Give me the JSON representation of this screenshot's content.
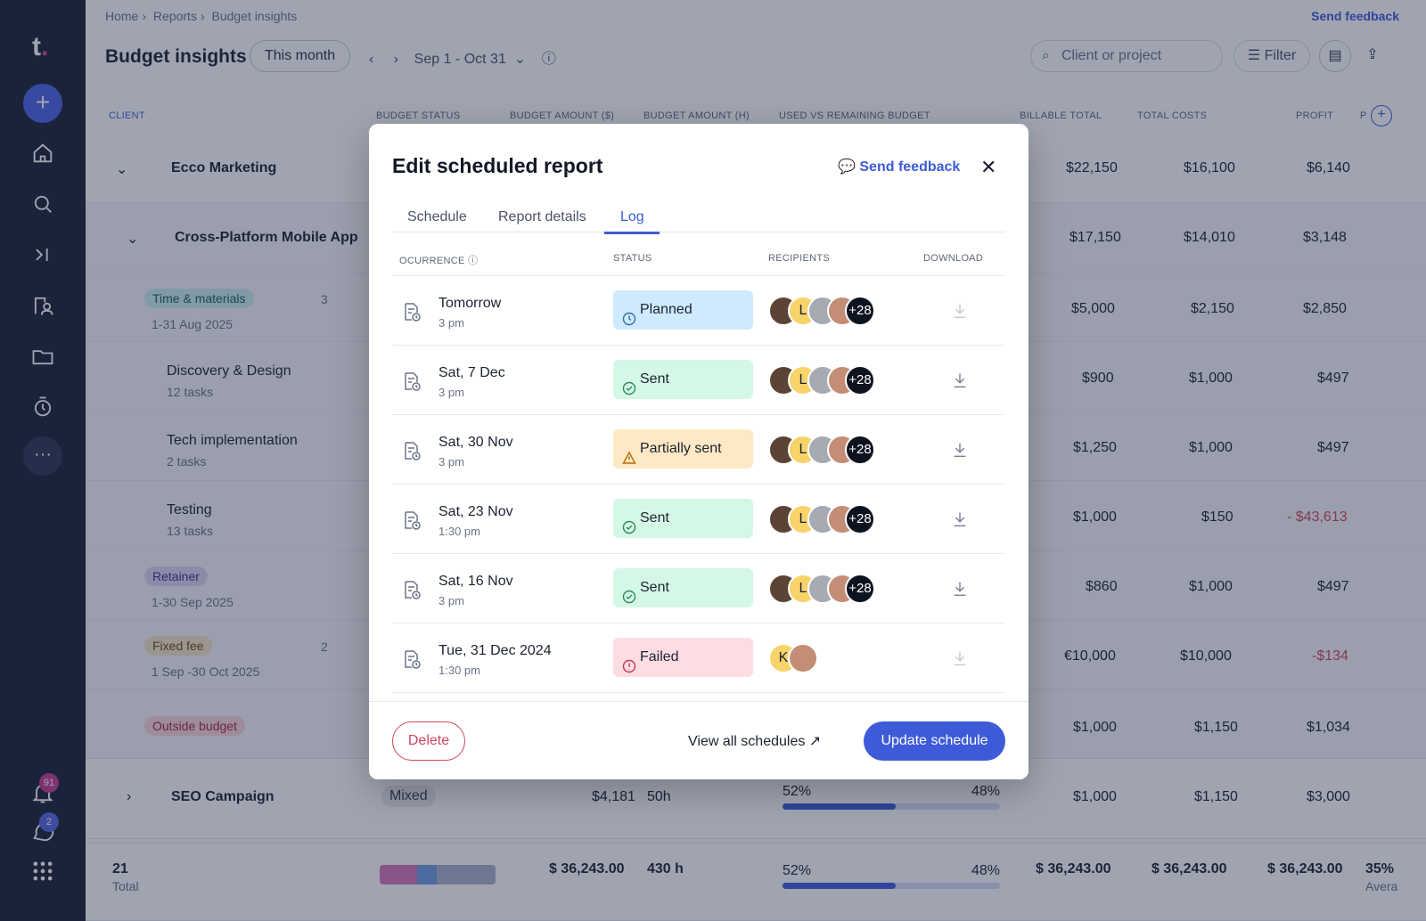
{
  "sidebar": {
    "logo_letter": "t",
    "logo_dot": ".",
    "add_label": "+",
    "more_label": "···",
    "notifications_count": "91",
    "messages_count": "2"
  },
  "header": {
    "breadcrumb": [
      "Home",
      "Reports",
      "Budget insights"
    ],
    "send_feedback": "Send feedback",
    "title": "Budget insights",
    "period": "This month",
    "date_range": "Sep 1 - Oct 31",
    "search_placeholder": "Client or project",
    "filter_label": "Filter"
  },
  "table": {
    "columns": [
      "CLIENT",
      "BUDGET STATUS",
      "BUDGET AMOUNT ($)",
      "BUDGET AMOUNT (H)",
      "USED VS REMAINING BUDGET",
      "BILLABLE TOTAL",
      "TOTAL COSTS",
      "PROFIT",
      "P"
    ],
    "rows": [
      {
        "name": "Ecco Marketing",
        "billable": "$22,150",
        "costs": "$16,100",
        "profit": "$6,140"
      },
      {
        "name": "Cross-Platform Mobile App",
        "billable": "$17,150",
        "costs": "$14,010",
        "profit": "$3,148"
      },
      {
        "chip": "Time & materials",
        "count": "3",
        "dates": "1-31 Aug 2025",
        "billable": "$5,000",
        "costs": "$2,150",
        "profit": "$2,850"
      },
      {
        "name": "Discovery & Design",
        "sub": "12 tasks",
        "billable": "$900",
        "costs": "$1,000",
        "profit": "$497"
      },
      {
        "name": "Tech implementation",
        "sub": "2 tasks",
        "billable": "$1,250",
        "costs": "$1,000",
        "profit": "$497"
      },
      {
        "name": "Testing",
        "sub": "13 tasks",
        "billable": "$1,000",
        "costs": "$150",
        "profit": "- $43,613"
      },
      {
        "chip": "Retainer",
        "dates": "1-30 Sep 2025",
        "billable": "$860",
        "costs": "$1,000",
        "profit": "$497"
      },
      {
        "chip": "Fixed fee",
        "count": "2",
        "dates": "1 Sep -30 Oct 2025",
        "billable": "€10,000",
        "costs": "$10,000",
        "profit": "-$134"
      },
      {
        "chip": "Outside budget",
        "billable": "$1,000",
        "costs": "$1,150",
        "profit": "$1,034"
      },
      {
        "name": "SEO Campaign",
        "status": "Mixed",
        "amount": "$4,181",
        "hours": "50h",
        "used": "52%",
        "remaining": "48%",
        "used_fraction": 0.52,
        "billable": "$1,000",
        "costs": "$1,150",
        "profit": "$3,000"
      }
    ],
    "totals": {
      "count": "21",
      "label": "Total",
      "amount": "$ 36,243.00",
      "hours": "430 h",
      "used": "52%",
      "remaining": "48%",
      "used_fraction": 0.52,
      "billable": "$ 36,243.00",
      "costs": "$ 36,243.00",
      "profit": "$ 36,243.00",
      "pct": "35%",
      "avg": "Avera"
    }
  },
  "modal": {
    "title": "Edit scheduled report",
    "send_feedback": "Send feedback",
    "tabs": [
      "Schedule",
      "Report details",
      "Log"
    ],
    "active_tab": "Log",
    "columns": [
      "OCURRENCE",
      "STATUS",
      "RECIPIENTS",
      "DOWNLOAD"
    ],
    "log": [
      {
        "date": "Tomorrow",
        "time": "3 pm",
        "status": "Planned",
        "kind": "planned",
        "more": "+28"
      },
      {
        "date": "Sat, 7 Dec",
        "time": "3 pm",
        "status": "Sent",
        "kind": "sent",
        "more": "+28"
      },
      {
        "date": "Sat, 30 Nov",
        "time": "3 pm",
        "status": "Partially sent",
        "kind": "partial",
        "more": "+28"
      },
      {
        "date": "Sat, 23 Nov",
        "time": "1:30 pm",
        "status": "Sent",
        "kind": "sent",
        "more": "+28"
      },
      {
        "date": "Sat, 16 Nov",
        "time": "3 pm",
        "status": "Sent",
        "kind": "sent",
        "more": "+28"
      },
      {
        "date": "Tue, 31 Dec 2024",
        "time": "1:30 pm",
        "status": "Failed",
        "kind": "failed",
        "more": ""
      }
    ],
    "avatar_initials": "L",
    "failed_initials": "K",
    "delete_label": "Delete",
    "view_all_label": "View all schedules",
    "update_label": "Update schedule"
  },
  "colors": {
    "accent": "#3d5bd9",
    "planned": "#cfeaff",
    "sent": "#d5f7e6",
    "partial": "#fde9c4",
    "failed": "#fddde2"
  }
}
